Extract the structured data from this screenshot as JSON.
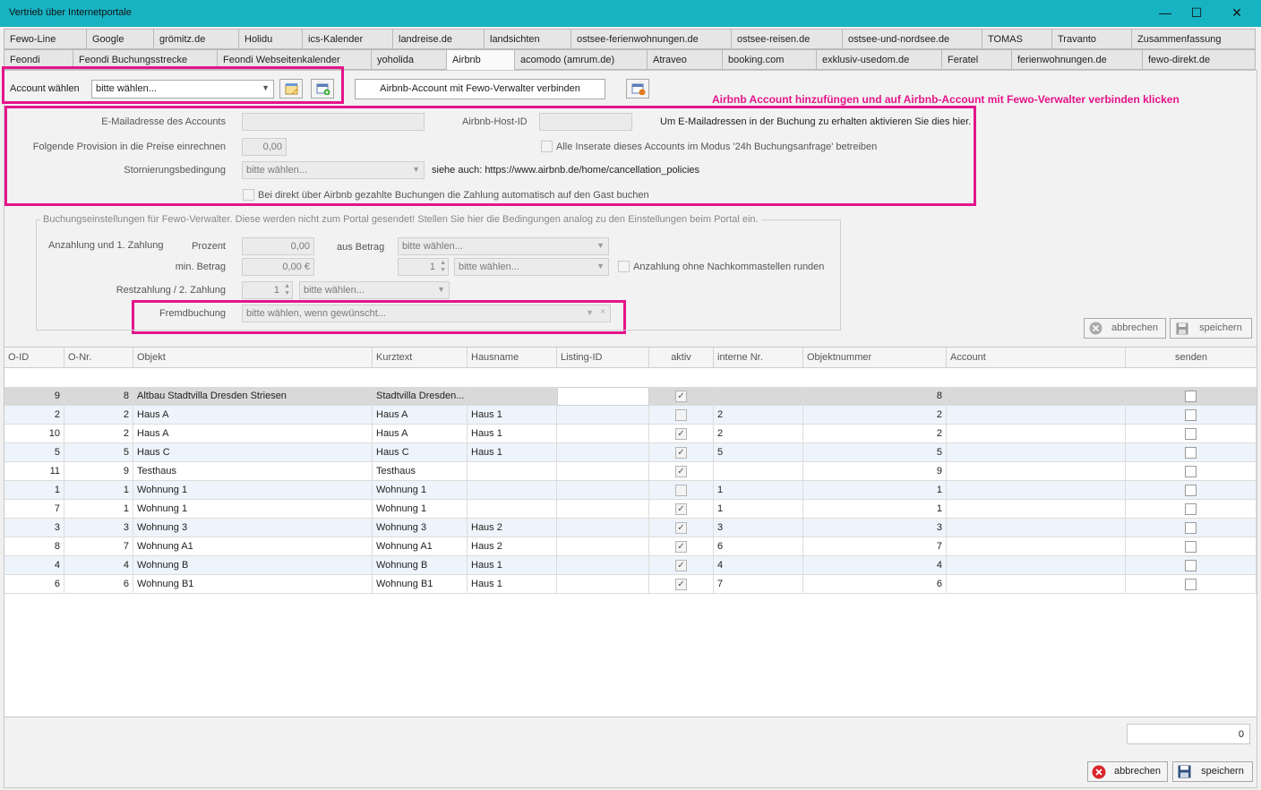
{
  "window": {
    "title": "Vertrieb über Internetportale",
    "minimize": "—",
    "maximize": "☐",
    "close": "✕"
  },
  "tabs_row1": [
    "Fewo-Line",
    "Google",
    "grömitz.de",
    "Holidu",
    "ics-Kalender",
    "landreise.de",
    "landsichten",
    "ostsee-ferienwohnungen.de",
    "ostsee-reisen.de",
    "ostsee-und-nordsee.de",
    "TOMAS",
    "Travanto",
    "Zusammenfassung"
  ],
  "tabs_row2": [
    "Feondi",
    "Feondi Buchungsstrecke",
    "Feondi Webseitenkalender",
    "yoholida",
    "Airbnb",
    "acomodo (amrum.de)",
    "Atraveo",
    "booking.com",
    "exklusiv-usedom.de",
    "Feratel",
    "ferienwohnungen.de",
    "fewo-direkt.de"
  ],
  "account": {
    "label": "Account wählen",
    "select_value": "bitte wählen...",
    "connect_button": "Airbnb-Account mit Fewo-Verwalter verbinden"
  },
  "annotation": "Airbnb Account hinzufüngen und auf Airbnb-Account mit Fewo-Verwalter verbinden klicken",
  "settings": {
    "email_label": "E-Mailadresse des Accounts",
    "email_value": "",
    "host_id_label": "Airbnb-Host-ID",
    "host_id_value": "",
    "email_hint": "Um E-Mailadressen in der Buchung zu erhalten aktivieren Sie dies hier.",
    "provision_label": "Folgende Provision in die Preise einrechnen",
    "provision_value": "0,00",
    "inserate_label": "Alle Inserate dieses Accounts im Modus '24h Buchungsanfrage' betreiben",
    "storno_label": "Stornierungsbedingung",
    "storno_value": "bitte wählen...",
    "storno_hint": "siehe auch: https://www.airbnb.de/home/cancellation_policies",
    "payment_label": "Bei direkt über Airbnb gezahlte Buchungen die Zahlung automatisch auf den Gast buchen"
  },
  "booking": {
    "group_title": "Buchungseinstellungen für Fewo-Verwalter. Diese werden nicht zum Portal gesendet! Stellen Sie hier die Bedingungen analog zu den Einstellungen beim Portal ein.",
    "anzahlung_label": "Anzahlung und 1. Zahlung",
    "prozent_label": "Prozent",
    "prozent_value": "0,00",
    "aus_betrag_label": "aus Betrag",
    "aus_betrag_value": "bitte wählen...",
    "min_betrag_label": "min. Betrag",
    "min_betrag_value": "0,00 €",
    "min_spin_value": "1",
    "min_select_value": "bitte wählen...",
    "runden_label": "Anzahlung ohne Nachkommastellen runden",
    "rest_label": "Restzahlung / 2. Zahlung",
    "rest_spin_value": "1",
    "rest_select_value": "bitte wählen...",
    "fremd_label": "Fremdbuchung",
    "fremd_value": "bitte wählen, wenn gewünscht...",
    "cancel_button": "abbrechen",
    "save_button": "speichern"
  },
  "table": {
    "columns": [
      "O-ID",
      "O-Nr.",
      "Objekt",
      "Kurztext",
      "Hausname",
      "Listing-ID",
      "aktiv",
      "interne Nr.",
      "Objektnummer",
      "Account",
      "senden"
    ],
    "rows": [
      {
        "oid": "9",
        "onr": "8",
        "objekt": "Altbau Stadtvilla Dresden Striesen",
        "kurz": "Stadtvilla Dresden...",
        "haus": "",
        "listing": "",
        "aktiv": true,
        "intern": "",
        "objnr": "8",
        "account": "",
        "senden": false
      },
      {
        "oid": "2",
        "onr": "2",
        "objekt": "Haus A",
        "kurz": "Haus A",
        "haus": "Haus 1",
        "listing": "",
        "aktiv": false,
        "intern": "2",
        "objnr": "2",
        "account": "",
        "senden": false
      },
      {
        "oid": "10",
        "onr": "2",
        "objekt": "Haus A",
        "kurz": "Haus A",
        "haus": "Haus 1",
        "listing": "",
        "aktiv": true,
        "intern": "2",
        "objnr": "2",
        "account": "",
        "senden": false
      },
      {
        "oid": "5",
        "onr": "5",
        "objekt": "Haus C",
        "kurz": "Haus C",
        "haus": "Haus 1",
        "listing": "",
        "aktiv": true,
        "intern": "5",
        "objnr": "5",
        "account": "",
        "senden": false
      },
      {
        "oid": "11",
        "onr": "9",
        "objekt": "Testhaus",
        "kurz": "Testhaus",
        "haus": "",
        "listing": "",
        "aktiv": true,
        "intern": "",
        "objnr": "9",
        "account": "",
        "senden": false
      },
      {
        "oid": "1",
        "onr": "1",
        "objekt": "Wohnung 1",
        "kurz": "Wohnung 1",
        "haus": "",
        "listing": "",
        "aktiv": false,
        "intern": "1",
        "objnr": "1",
        "account": "",
        "senden": false
      },
      {
        "oid": "7",
        "onr": "1",
        "objekt": "Wohnung 1",
        "kurz": "Wohnung 1",
        "haus": "",
        "listing": "",
        "aktiv": true,
        "intern": "1",
        "objnr": "1",
        "account": "",
        "senden": false
      },
      {
        "oid": "3",
        "onr": "3",
        "objekt": "Wohnung 3",
        "kurz": "Wohnung 3",
        "haus": "Haus 2",
        "listing": "",
        "aktiv": true,
        "intern": "3",
        "objnr": "3",
        "account": "",
        "senden": false
      },
      {
        "oid": "8",
        "onr": "7",
        "objekt": "Wohnung A1",
        "kurz": "Wohnung A1",
        "haus": "Haus 2",
        "listing": "",
        "aktiv": true,
        "intern": "6",
        "objnr": "7",
        "account": "",
        "senden": false
      },
      {
        "oid": "4",
        "onr": "4",
        "objekt": "Wohnung B",
        "kurz": "Wohnung B",
        "haus": "Haus 1",
        "listing": "",
        "aktiv": true,
        "intern": "4",
        "objnr": "4",
        "account": "",
        "senden": false
      },
      {
        "oid": "6",
        "onr": "6",
        "objekt": "Wohnung B1",
        "kurz": "Wohnung B1",
        "haus": "Haus 1",
        "listing": "",
        "aktiv": true,
        "intern": "7",
        "objnr": "6",
        "account": "",
        "senden": false
      }
    ],
    "count": "0"
  },
  "footer": {
    "cancel_button": "abbrechen",
    "save_button": "speichern"
  },
  "colors": {
    "titlebar": "#17b3c3",
    "highlight": "#e4148a",
    "selected_row": "#d9d9d9",
    "alt_row": "#eef4fb"
  }
}
